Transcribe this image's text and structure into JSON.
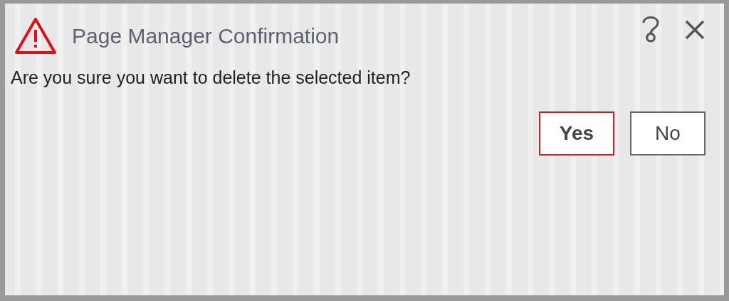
{
  "dialog": {
    "title": "Page Manager Confirmation",
    "message": "Are you sure you want to delete the selected item?",
    "buttons": [
      {
        "label": "Yes",
        "focused": true
      },
      {
        "label": "No",
        "focused": false
      }
    ]
  }
}
